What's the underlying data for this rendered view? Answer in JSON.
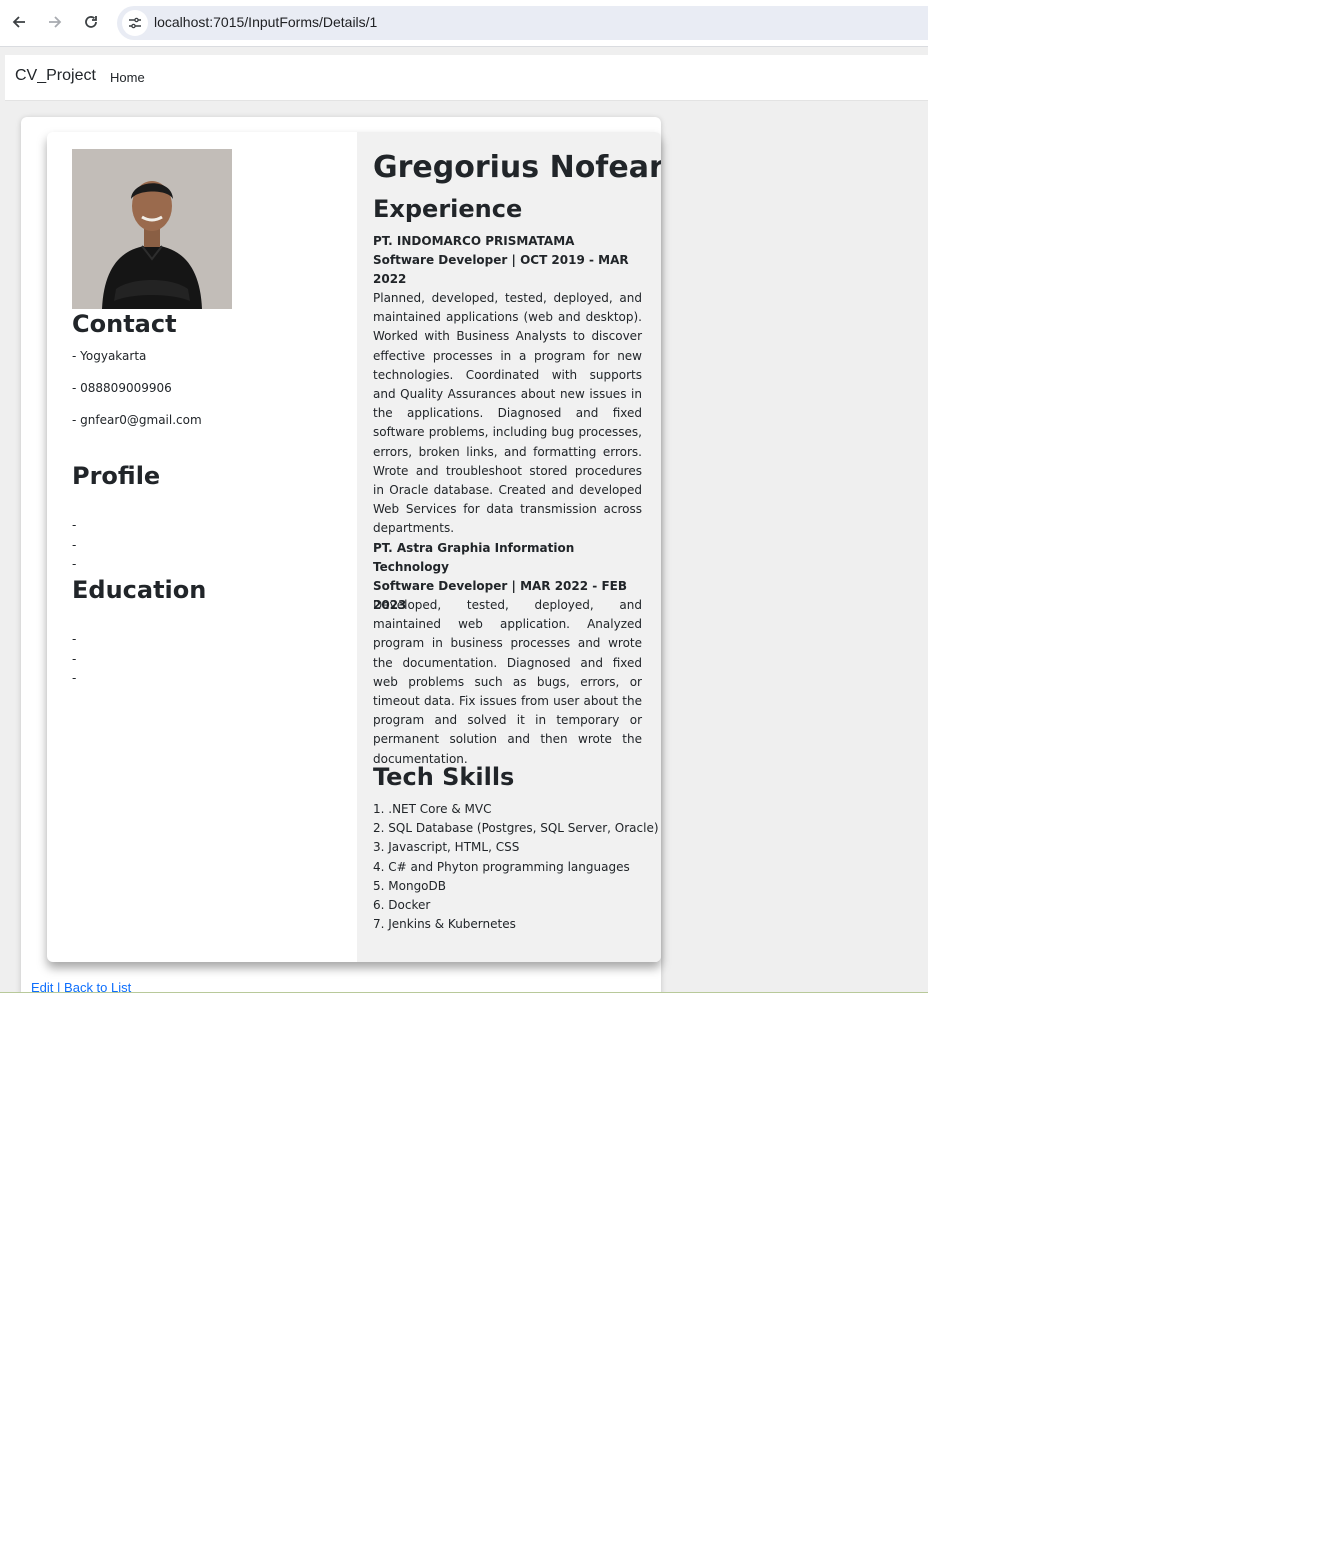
{
  "browser": {
    "url": "localhost:7015/InputForms/Details/1",
    "back_icon": "arrow-left-icon",
    "forward_icon": "arrow-right-icon",
    "reload_icon": "reload-icon",
    "site_info_icon": "tune-icon"
  },
  "navbar": {
    "brand": "CV_Project",
    "links": [
      "Home"
    ]
  },
  "cv": {
    "name": "Gregorius Nofear",
    "contact": {
      "heading": "Contact",
      "location": "- Yogyakarta",
      "phone": "- 088809009906",
      "email": "- gnfear0@gmail.com"
    },
    "profile": {
      "heading": "Profile",
      "items": [
        "-",
        "-",
        "-"
      ]
    },
    "education": {
      "heading": "Education",
      "items": [
        "-",
        "-",
        "-"
      ]
    },
    "experience": {
      "heading": "Experience",
      "jobs": [
        {
          "company": "PT. INDOMARCO PRISMATAMA",
          "role": "Software Developer | OCT 2019 - MAR 2022",
          "description": "Planned, developed, tested, deployed, and maintained applications (web and desktop). Worked with Business Analysts to discover effective processes in a program for new technologies. Coordinated with supports and Quality Assurances about new issues in the applications. Diagnosed and fixed software problems, including bug processes, errors, broken links, and formatting errors. Wrote and troubleshoot stored procedures in Oracle database. Created and developed Web Services for data transmission across departments."
        },
        {
          "company": "PT. Astra Graphia Information Technology",
          "role": "Software Developer | MAR 2022 - FEB 2023",
          "description": "Developed, tested, deployed, and maintained web application. Analyzed program in business processes and wrote the documentation. Diagnosed and fixed web problems such as bugs, errors, or timeout data. Fix issues from user about the program and solved it in temporary or permanent solution and then wrote the documentation."
        }
      ]
    },
    "tech_skills": {
      "heading": "Tech Skills",
      "items": [
        "1. .NET Core & MVC",
        "2. SQL Database (Postgres, SQL Server, Oracle)",
        "3. Javascript, HTML, CSS",
        "4. C# and Phyton programming languages",
        "5. MongoDB",
        "6. Docker",
        "7. Jenkins & Kubernetes"
      ]
    }
  },
  "footer": {
    "edit_label": "Edit",
    "separator": "|",
    "back_label": "Back to List"
  }
}
